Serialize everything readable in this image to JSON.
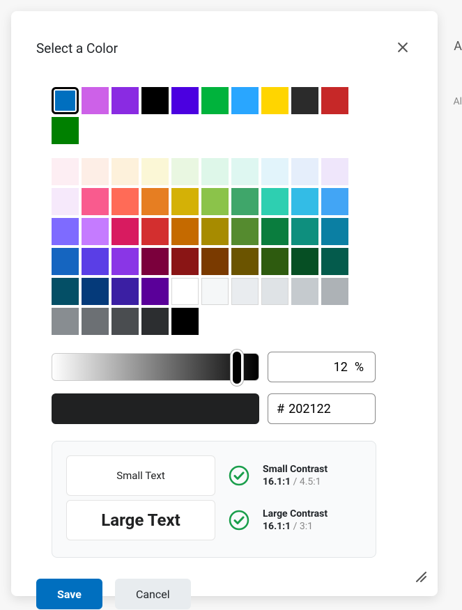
{
  "dialog": {
    "title": "Select a Color",
    "close_icon": "close"
  },
  "background_fragments": {
    "frag1": "A",
    "frag2": "Al"
  },
  "palette_primary": [
    {
      "hex": "#006fbf",
      "selected": true
    },
    {
      "hex": "#cd61e8"
    },
    {
      "hex": "#8a2be2"
    },
    {
      "hex": "#000000"
    },
    {
      "hex": "#4b00e0"
    },
    {
      "hex": "#00b33c"
    },
    {
      "hex": "#29a6ff"
    },
    {
      "hex": "#ffd500"
    },
    {
      "hex": "#2b2b2b"
    },
    {
      "hex": "#c62828"
    },
    {
      "hex": "#008000"
    }
  ],
  "palette_extended": [
    {
      "hex": "#fdeef3"
    },
    {
      "hex": "#fdeee6"
    },
    {
      "hex": "#fdf1db"
    },
    {
      "hex": "#fbf7d6"
    },
    {
      "hex": "#e9f7e1"
    },
    {
      "hex": "#def7e9"
    },
    {
      "hex": "#def7f1"
    },
    {
      "hex": "#e2f4fb"
    },
    {
      "hex": "#e5eefb"
    },
    {
      "hex": "#efe6fb"
    },
    {
      "hex": "#f6e9fb"
    },
    {
      "hex": "#f95b8e"
    },
    {
      "hex": "#ff6b57"
    },
    {
      "hex": "#e67e22"
    },
    {
      "hex": "#d4b106"
    },
    {
      "hex": "#8bc34a"
    },
    {
      "hex": "#3fa66a"
    },
    {
      "hex": "#2ecfb1"
    },
    {
      "hex": "#33bce6"
    },
    {
      "hex": "#42a5f5"
    },
    {
      "hex": "#7e6bff"
    },
    {
      "hex": "#c57bff"
    },
    {
      "hex": "#d81b60"
    },
    {
      "hex": "#d32f2f"
    },
    {
      "hex": "#c56a00"
    },
    {
      "hex": "#a78b00"
    },
    {
      "hex": "#558b2f"
    },
    {
      "hex": "#0a7d3e"
    },
    {
      "hex": "#0e8f7e"
    },
    {
      "hex": "#0b7fa3"
    },
    {
      "hex": "#1565c0"
    },
    {
      "hex": "#5a3ee6"
    },
    {
      "hex": "#8a36e6"
    },
    {
      "hex": "#7b003c"
    },
    {
      "hex": "#8a1515"
    },
    {
      "hex": "#7a3a00"
    },
    {
      "hex": "#6b5400"
    },
    {
      "hex": "#2e5b0f"
    },
    {
      "hex": "#064f24"
    },
    {
      "hex": "#045b4c"
    },
    {
      "hex": "#044f66"
    },
    {
      "hex": "#053a7a"
    },
    {
      "hex": "#3b1fa3"
    },
    {
      "hex": "#5a0099"
    },
    {
      "hex": "#ffffff",
      "bordered": true
    },
    {
      "hex": "#f5f7f8",
      "bordered": true
    },
    {
      "hex": "#e9ecef",
      "bordered": true
    },
    {
      "hex": "#dfe3e6",
      "bordered": true
    },
    {
      "hex": "#c5cace"
    },
    {
      "hex": "#adb2b6"
    },
    {
      "hex": "#888d91"
    },
    {
      "hex": "#6c7074"
    },
    {
      "hex": "#4a4d50"
    },
    {
      "hex": "#2c2e30"
    },
    {
      "hex": "#000000"
    }
  ],
  "lightness": {
    "value": "12",
    "unit": "%"
  },
  "hex": {
    "prefix": "#",
    "value": "202122"
  },
  "preview_color": "#202122",
  "contrast": {
    "small_sample": "Small Text",
    "large_sample": "Large Text",
    "small": {
      "label": "Small Contrast",
      "ratio": "16.1:1",
      "required": "4.5:1"
    },
    "large": {
      "label": "Large Contrast",
      "ratio": "16.1:1",
      "required": "3:1"
    }
  },
  "buttons": {
    "save": "Save",
    "cancel": "Cancel"
  }
}
